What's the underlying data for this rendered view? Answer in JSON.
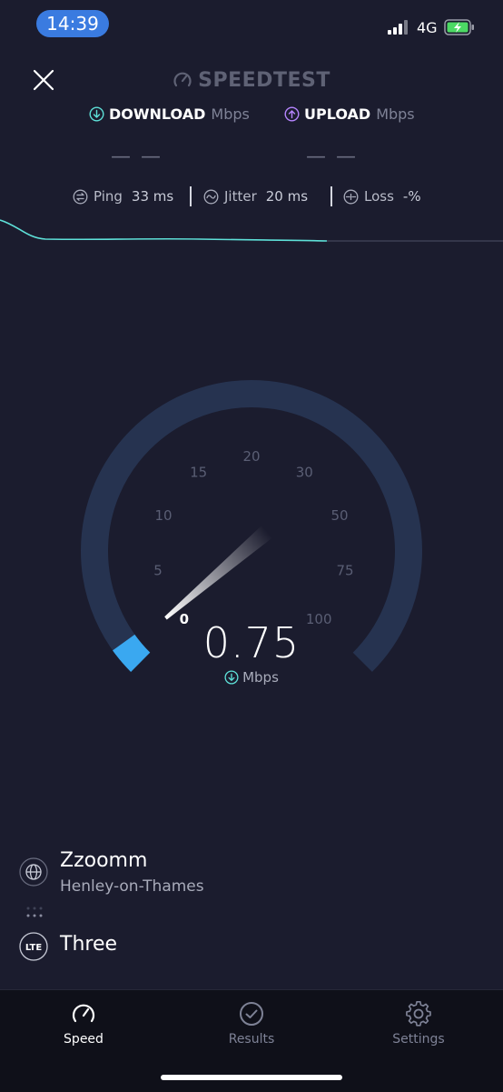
{
  "status_bar": {
    "time": "14:39",
    "network": "4G"
  },
  "header": {
    "brand": "SPEEDTEST",
    "download_label": "DOWNLOAD",
    "download_unit": "Mbps",
    "upload_label": "UPLOAD",
    "upload_unit": "Mbps",
    "download_value": "— —",
    "upload_value": "— —"
  },
  "stats": {
    "ping_label": "Ping",
    "ping_value": "33 ms",
    "jitter_label": "Jitter",
    "jitter_value": "20 ms",
    "loss_label": "Loss",
    "loss_value": "-%"
  },
  "gauge": {
    "ticks": [
      "0",
      "5",
      "10",
      "15",
      "20",
      "30",
      "50",
      "75",
      "100"
    ],
    "current_value": 0.75,
    "current_display": "0.75",
    "unit": "Mbps"
  },
  "connection": {
    "provider": "Zzoomm",
    "location": "Henley-on-Thames",
    "carrier": "Three",
    "carrier_badge": "LTE"
  },
  "tabs": [
    {
      "label": "Speed",
      "active": true
    },
    {
      "label": "Results",
      "active": false
    },
    {
      "label": "Settings",
      "active": false
    }
  ],
  "colors": {
    "background": "#1b1c2e",
    "download_accent": "#5ee0d8",
    "upload_accent": "#b685ff",
    "gauge_track": "#263350",
    "gauge_fill": "#3aa8f0"
  }
}
